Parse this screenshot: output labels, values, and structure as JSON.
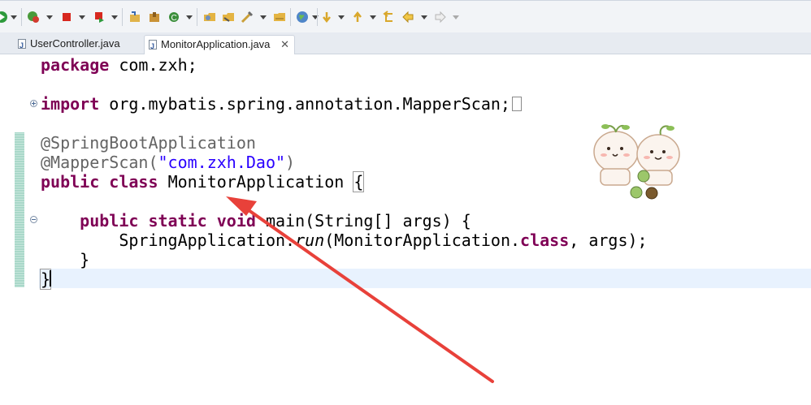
{
  "toolbar": {
    "icons": [
      "run-icon",
      "debug-icon",
      "stop-icon",
      "coverage-icon",
      "new-java-project-icon",
      "new-package-icon",
      "new-class-icon",
      "open-type-icon",
      "open-task-icon",
      "search-icon",
      "open-folder-icon",
      "globe-icon",
      "next-annotation-icon",
      "previous-annotation-icon",
      "last-edit-location-icon",
      "back-icon",
      "forward-icon"
    ]
  },
  "tabs": [
    {
      "label": "UserController.java",
      "active": false
    },
    {
      "label": "MonitorApplication.java",
      "active": true,
      "close": "✕"
    }
  ],
  "code": {
    "line1_kw": "package",
    "line1_rest": " com.zxh;",
    "line2_kw": "import",
    "line2_rest": " org.mybatis.spring.annotation.MapperScan;",
    "line3": "@SpringBootApplication",
    "line4_ann": "@MapperScan(",
    "line4_str": "\"com.zxh.Dao\"",
    "line4_close": ")",
    "line5_kw1": "public",
    "line5_kw2": "class",
    "line5_name": "MonitorApplication",
    "line5_brace": "{",
    "line6_kw1": "public",
    "line6_kw2": "static",
    "line6_kw3": "void",
    "line6_rest": " main(String[] args) {",
    "line7_a": "SpringApplication.",
    "line7_run": "run",
    "line7_b": "(MonitorApplication.",
    "line7_kw": "class",
    "line7_c": ", args);",
    "line8": "}",
    "line9": "}"
  },
  "colors": {
    "keyword": "#7f0055",
    "annotation": "#646464",
    "string": "#2a00ff",
    "arrow": "#e8413a"
  }
}
